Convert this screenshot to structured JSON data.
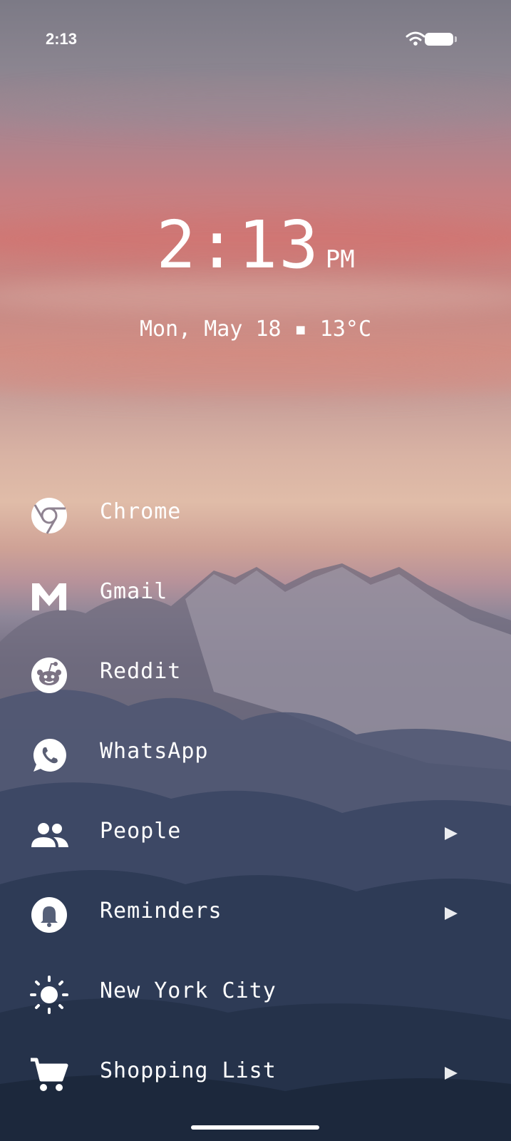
{
  "status_bar": {
    "time": "2:13",
    "icons": [
      "wifi-icon",
      "battery-icon"
    ]
  },
  "clock": {
    "time": "2:13",
    "ampm": "PM"
  },
  "date_line": "Mon, May 18 ▪ 13°C",
  "apps": [
    {
      "label": "Chrome",
      "icon": "chrome-icon",
      "has_arrow": false
    },
    {
      "label": "Gmail",
      "icon": "gmail-icon",
      "has_arrow": false
    },
    {
      "label": "Reddit",
      "icon": "reddit-icon",
      "has_arrow": false
    },
    {
      "label": "WhatsApp",
      "icon": "whatsapp-icon",
      "has_arrow": false
    },
    {
      "label": "People",
      "icon": "people-icon",
      "has_arrow": true
    },
    {
      "label": "Reminders",
      "icon": "bell-icon",
      "has_arrow": true
    },
    {
      "label": "New York City",
      "icon": "sun-icon",
      "has_arrow": false
    },
    {
      "label": "Shopping List",
      "icon": "cart-icon",
      "has_arrow": true
    }
  ],
  "colors": {
    "text": "#ffffff",
    "sky_top": "#7c7a86",
    "sky_pink": "#cf7c78",
    "ground": "#1f2c42"
  }
}
